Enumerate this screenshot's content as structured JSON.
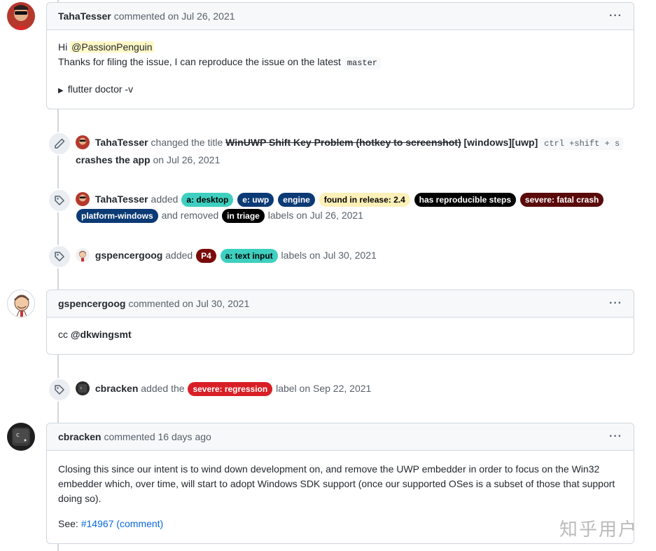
{
  "comments": [
    {
      "author": "TahaTesser",
      "meta": "commented on Jul 26, 2021",
      "greeting": "Hi",
      "mention": "@PassionPenguin",
      "line2_text": "Thanks for filing the issue, I can reproduce the issue on the latest",
      "line2_code": "master",
      "details_summary": "flutter doctor -v"
    },
    {
      "author": "gspencergoog",
      "meta": "commented on Jul 30, 2021",
      "cc": "cc",
      "mention": "@dkwingsmt"
    },
    {
      "author": "cbracken",
      "meta": "commented 16 days ago",
      "paragraph": "Closing this since our intent is to wind down development on, and remove the UWP embedder in order to focus on the Win32 embedder which, over time, will start to adopt Windows SDK support (once our supported OSes is a subset of those that support doing so).",
      "see_label": "See:",
      "see_link": "#14967 (comment)"
    }
  ],
  "events": {
    "rename": {
      "author": "TahaTesser",
      "action": "changed the title",
      "old_title": "WinUWP Shift Key Problem (hotkey to screenshot)",
      "new_title_prefix": "[windows][uwp]",
      "new_title_code": "ctrl +shift + s",
      "new_title_suffix": "crashes the app",
      "when": "on Jul 26, 2021"
    },
    "labels1": {
      "author": "TahaTesser",
      "added_word": "added",
      "removed_word": "and removed",
      "suffix": "labels on Jul 26, 2021",
      "added": [
        {
          "text": "a: desktop",
          "bg": "#3ecfc0",
          "fg": "#000000"
        },
        {
          "text": "e: uwp",
          "bg": "#0b3a75",
          "fg": "#ffffff"
        },
        {
          "text": "engine",
          "bg": "#0b3a75",
          "fg": "#ffffff"
        },
        {
          "text": "found in release: 2.4",
          "bg": "#fdf0b8",
          "fg": "#000000"
        },
        {
          "text": "has reproducible steps",
          "bg": "#000000",
          "fg": "#ffffff"
        },
        {
          "text": "severe: fatal crash",
          "bg": "#5a0a0a",
          "fg": "#ffffff"
        },
        {
          "text": "platform-windows",
          "bg": "#0b3a75",
          "fg": "#ffffff"
        }
      ],
      "removed": [
        {
          "text": "in triage",
          "bg": "#000000",
          "fg": "#ffffff"
        }
      ]
    },
    "labels2": {
      "author": "gspencergoog",
      "added_word": "added",
      "suffix": "labels on Jul 30, 2021",
      "added": [
        {
          "text": "P4",
          "bg": "#7a0a0a",
          "fg": "#ffffff"
        },
        {
          "text": "a: text input",
          "bg": "#3ecfc0",
          "fg": "#000000"
        }
      ]
    },
    "labels3": {
      "author": "cbracken",
      "added_word": "added the",
      "suffix": "label on Sep 22, 2021",
      "added": [
        {
          "text": "severe: regression",
          "bg": "#d91f26",
          "fg": "#ffffff"
        }
      ]
    }
  },
  "kebab": "···",
  "icons": {
    "edit": "pencil-icon",
    "label": "tag-icon",
    "menu": "kebab-icon",
    "disclosure": "triangle-right-icon"
  },
  "watermark": "知乎用户"
}
